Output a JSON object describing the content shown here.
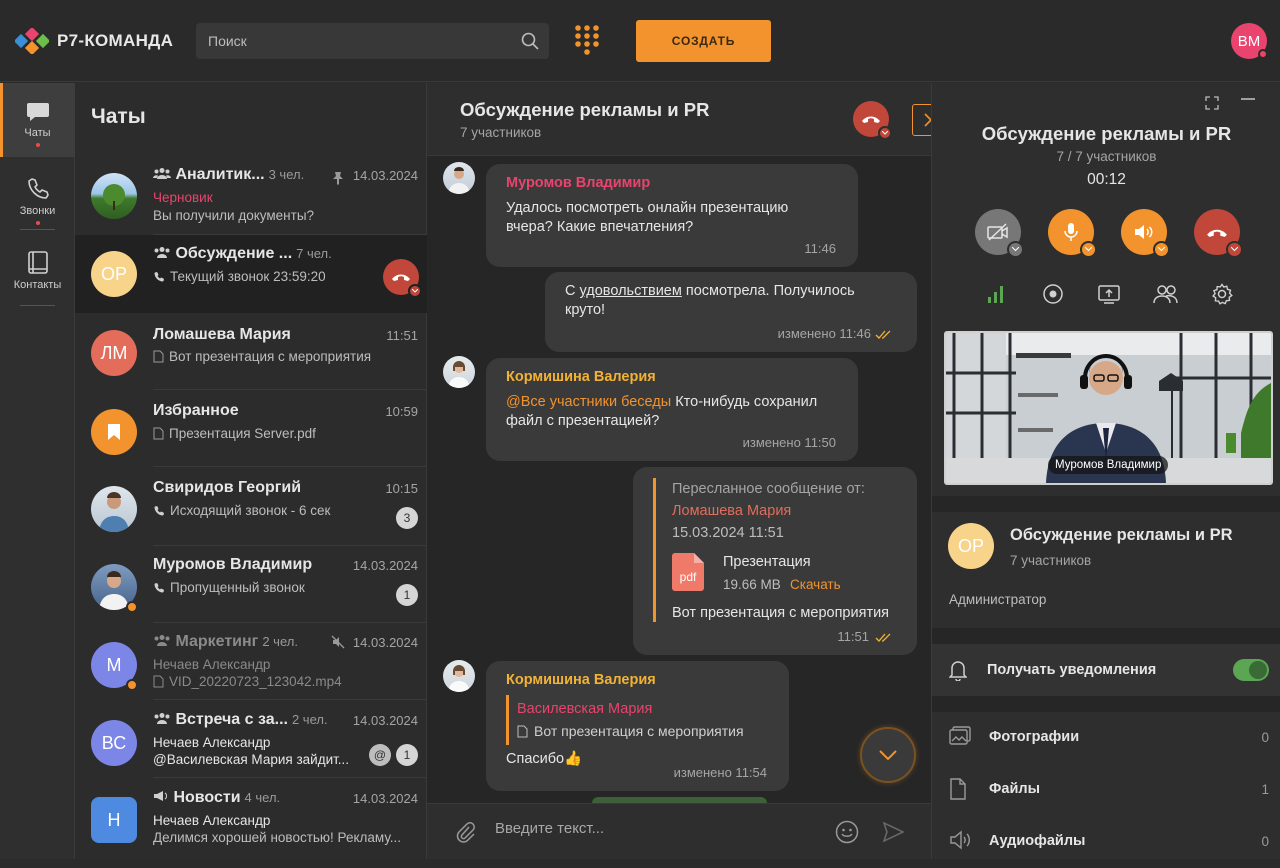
{
  "topbar": {
    "logo_text": "Р7-КОМАНДА",
    "search_placeholder": "Поиск",
    "create_label": "СОЗДАТЬ",
    "user_initials": "ВМ"
  },
  "nav": {
    "chats": "Чаты",
    "calls": "Звонки",
    "contacts": "Контакты"
  },
  "chatlist": {
    "title": "Чаты",
    "items": [
      {
        "name": "Аналитик...",
        "meta": "3 чел.",
        "time": "14.03.2024",
        "draft": "Черновик",
        "preview": "Вы получили документы?"
      },
      {
        "name": "Обсуждение ...",
        "meta": "7 чел.",
        "time": "",
        "initials": "ОР",
        "preview": "Текущий звонок 23:59:20"
      },
      {
        "name": "Ломашева Мария",
        "time": "11:51",
        "initials": "ЛМ",
        "preview": "Вот презентация с мероприятия"
      },
      {
        "name": "Избранное",
        "time": "10:59",
        "preview": "Презентация Server.pdf"
      },
      {
        "name": "Свиридов Георгий",
        "time": "10:15",
        "preview": "Исходящий звонок - 6 сек",
        "badge": "3"
      },
      {
        "name": "Муромов Владимир",
        "time": "14.03.2024",
        "preview": "Пропущенный звонок",
        "badge": "1"
      },
      {
        "name": "Маркетинг",
        "meta": "2 чел.",
        "time": "14.03.2024",
        "initials": "М",
        "line2": "Нечаев Александр",
        "preview": "VID_20220723_123042.mp4"
      },
      {
        "name": "Встреча с за...",
        "meta": "2 чел.",
        "time": "14.03.2024",
        "initials": "ВС",
        "line2": "Нечаев Александр",
        "preview": "@Василевская Мария зайдит...",
        "mention": "@",
        "badge": "1"
      },
      {
        "name": "Новости",
        "meta": "4 чел.",
        "time": "14.03.2024",
        "initials": "Н",
        "line2": "Нечаев Александр",
        "preview": "Делимся хорошей новостью! Рекламу..."
      }
    ]
  },
  "chat": {
    "title": "Обсуждение рекламы и PR",
    "subtitle": "7 участников",
    "input_placeholder": "Введите текст...",
    "messages": [
      {
        "sender": "Муромов Владимир",
        "text1": "Удалось посмотреть онлайн презентацию",
        "text2": "вчера? Какие впечатления?",
        "time": "11:46"
      },
      {
        "pre": "С ",
        "underline": "удовольствием",
        "post": " посмотрела. Получилось",
        "text2": "круто!",
        "time": "изменено 11:46"
      },
      {
        "sender": "Кормишина Валерия",
        "mention": "@Все участники беседы",
        "text1": " Кто-нибудь сохранил",
        "text2": "файл с презентацией?",
        "time": "изменено 11:50"
      },
      {
        "fwd_label": "Пересланное сообщение от:",
        "fwd_name": "Ломашева Мария",
        "fwd_date": "15.03.2024 11:51",
        "file_name": "Презентация",
        "file_size": "19.66 MB",
        "file_download": "Скачать",
        "file_type": "pdf",
        "text": "Вот презентация с мероприятия",
        "time": "11:51"
      },
      {
        "sender": "Кормишина Валерия",
        "quote_name": "Василевская Мария",
        "quote_text": "Вот презентация с мероприятия",
        "text": "Спасибо👍",
        "time": "изменено 11:54"
      }
    ]
  },
  "call_panel": {
    "title": "Обсуждение рекламы и PR",
    "participants": "7 / 7 участников",
    "timer": "00:12",
    "video_label": "Муромов Владимир"
  },
  "info": {
    "initials": "ОР",
    "title": "Обсуждение рекламы и PR",
    "subtitle": "7 участников",
    "role": "Администратор",
    "notify_label": "Получать уведомления",
    "media": [
      {
        "label": "Фотографии",
        "count": "0"
      },
      {
        "label": "Файлы",
        "count": "1"
      },
      {
        "label": "Аудиофайлы",
        "count": "0"
      }
    ]
  },
  "colors": {
    "accent": "#f2932e",
    "danger": "#c0473a",
    "sender_red": "#e8446e",
    "sender_orange": "#f2b233"
  }
}
